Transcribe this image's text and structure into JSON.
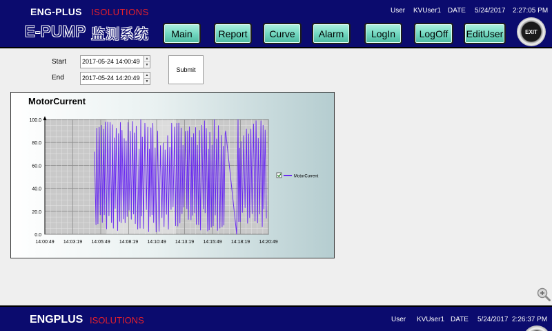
{
  "header": {
    "brand": "ENG-PLUS",
    "brand_sub": "ISOLUTIONS",
    "product": "E-PUMP",
    "product_cn": "监测系统",
    "user_label": "User",
    "user_name": "KVUser1",
    "date_label": "DATE",
    "date": "5/24/2017",
    "time": "2:27:05 PM",
    "nav": [
      "Main",
      "Report",
      "Curve",
      "Alarm",
      "LogIn",
      "LogOff",
      "EditUser"
    ],
    "exit_label": "EXIT"
  },
  "query": {
    "start_label": "Start",
    "start_value": "2017-05-24 14:00:49",
    "end_label": "End",
    "end_value": "2017-05-24 14:20:49",
    "submit_label": "Submit"
  },
  "chart_data": {
    "type": "line",
    "title": "MotorCurrent",
    "ylim": [
      0,
      100
    ],
    "yticks": [
      "0.0",
      "20.0",
      "40.0",
      "60.0",
      "80.0",
      "100.0"
    ],
    "xticks": [
      "14:00:49",
      "14:03:19",
      "14:05:49",
      "14:08:19",
      "14:10:49",
      "14:13:19",
      "14:15:49",
      "14:18:19",
      "14:20:49"
    ],
    "grid": true,
    "legend_position": "right",
    "series": [
      {
        "name": "MotorCurrent",
        "color": "#6a2cf0"
      }
    ]
  },
  "footer": {
    "brand": "ENGPLUS",
    "brand_sub": "ISOLUTIONS",
    "user_label": "User",
    "user_name": "KVUser1",
    "date_label": "DATE",
    "date": "5/24/2017",
    "time": "2:26:37 PM"
  },
  "colors": {
    "header_bg": "#0b0b6e",
    "button_bg": "#6fd6be",
    "series": "#6a2cf0",
    "accent_red": "#e8202a"
  },
  "icons": {
    "zoom": "zoom-in-icon",
    "exit": "exit-icon"
  }
}
